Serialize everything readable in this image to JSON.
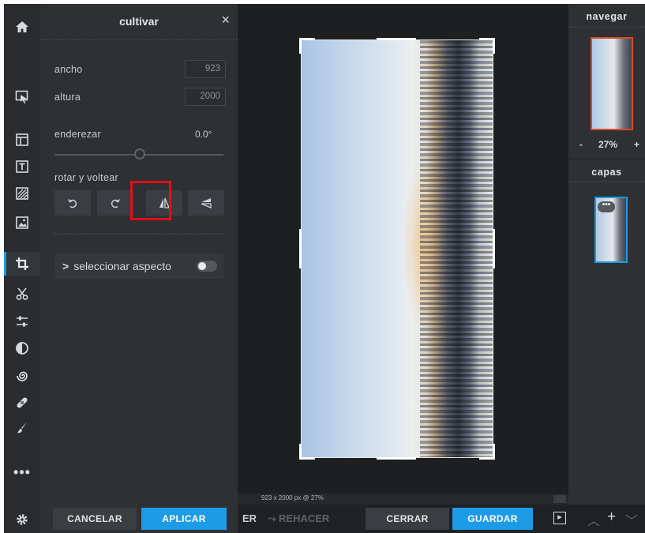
{
  "crop_panel": {
    "title": "cultivar",
    "close_icon": "×",
    "width_label": "ancho",
    "width_value": "923",
    "height_label": "altura",
    "height_value": "2000",
    "straighten_label": "enderezar",
    "straighten_value": "0.0°",
    "rotate_label": "rotar y voltear",
    "aspect_label": "seleccionar aspecto",
    "aspect_chevron": ">"
  },
  "canvas": {
    "status_text": "923 x 2000 px @ 27%"
  },
  "right_panel": {
    "navigate_title": "navegar",
    "zoom_minus": "-",
    "zoom_value": "27%",
    "zoom_plus": "+",
    "layers_title": "capas",
    "layer_more": "•••"
  },
  "bottom_bar": {
    "cancel_label": "CANCELAR",
    "apply_label": "APLICAR",
    "undo_partial": "ER",
    "redo_label": "⤳ REHACER",
    "close_label": "CERRAR",
    "save_label": "GUARDAR",
    "panel_toggle": "▸",
    "up_arrow": "︿",
    "add": "+",
    "down_arrow": "﹀"
  },
  "rail": {
    "more": "•••"
  },
  "colors": {
    "accent": "#1c9be6",
    "highlight": "#e01018",
    "nav_frame": "#d84b2a"
  }
}
